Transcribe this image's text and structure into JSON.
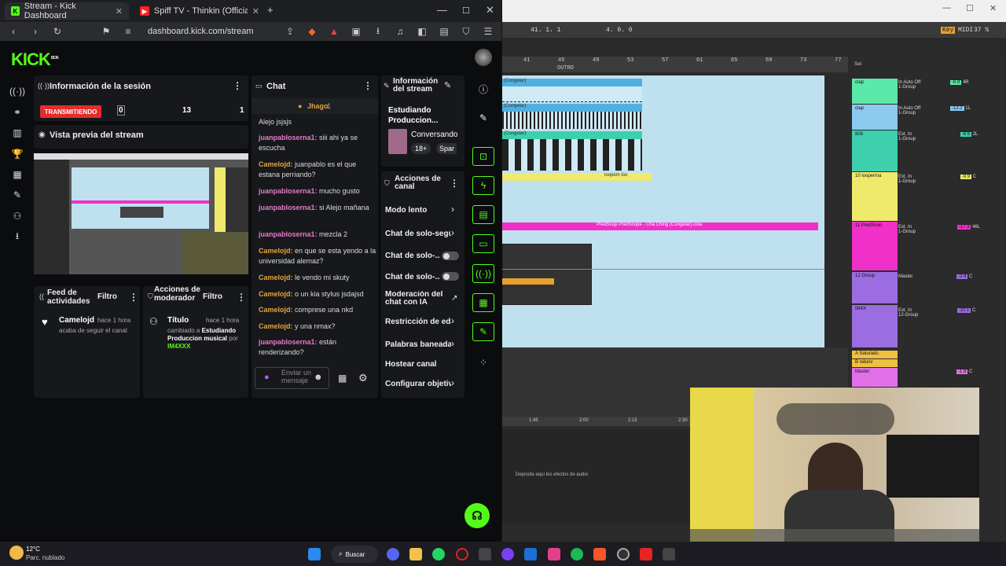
{
  "browser": {
    "tabs": [
      {
        "label": "Stream - Kick Dashboard",
        "favicon": "kick-icon"
      },
      {
        "label": "Spiff TV - Thinkin (Official Video) ft. A",
        "favicon": "youtube-icon"
      }
    ],
    "new_tab": "+",
    "window_controls": {
      "minimize": "—",
      "maximize": "☐",
      "close": "✕"
    },
    "url": "dashboard.kick.com/stream"
  },
  "kick": {
    "logo": "KICK",
    "logo_tag": "BETA",
    "session": {
      "title": "Información de la sesión",
      "status_badge": "TRANSMITIENDO",
      "stats": [
        "0",
        "13",
        "1"
      ]
    },
    "preview_title": "Vista previa del stream",
    "activity_feed": {
      "title": "Feed de actividades",
      "filter": "Filtro",
      "item": {
        "user": "Camelojd",
        "time": "hace 1 hora",
        "text": "acaba de seguir el canal"
      }
    },
    "mod_actions": {
      "title": "Acciones de moderador",
      "filter": "Filtro",
      "item": {
        "field": "Título",
        "time": "hace 1 hora",
        "text_prefix": "cambiado a",
        "value": "Estudiando Produccion musical",
        "text_by": "por",
        "user": "IM4XXX"
      }
    },
    "chat": {
      "title": "Chat",
      "pinned_user": "Jhago",
      "pinned_count": "1",
      "messages": [
        {
          "user": "",
          "text": "Alejo jsjsjs"
        },
        {
          "user": "juanpabloserna1:",
          "text": "siii ahi ya se escucha"
        },
        {
          "user": "Camelojd:",
          "text": "juanpablo es el que estana perriando?"
        },
        {
          "user": "juanpabloserna1:",
          "text": "mucho gusto"
        },
        {
          "user": "juanpabloserna1:",
          "text": "si Alejo mañana"
        },
        {
          "user": "juanpabloserna1:",
          "text": "mezcla 2"
        },
        {
          "user": "Camelojd:",
          "text": "en que se esta yendo a la universidad alemaz?"
        },
        {
          "user": "Camelojd:",
          "text": "le vendo mi skuty"
        },
        {
          "user": "Camelojd:",
          "text": "o un kia stylus jsdajsd"
        },
        {
          "user": "Camelojd:",
          "text": "comprese una nkd"
        },
        {
          "user": "Camelojd:",
          "text": "y una nmax?"
        },
        {
          "user": "juanpabloserna1:",
          "text": "están renderizando?"
        }
      ],
      "input_placeholder": "Enviar un mensaje"
    },
    "stream_info": {
      "title": "Información del stream",
      "stream_title": "Estudiando Produccion...",
      "category": "Conversando",
      "tags": [
        "18+",
        "Spar"
      ]
    },
    "stream_actions": {
      "title": "Acciones de canal",
      "items": [
        "Modo lento",
        "Chat de solo-seguidores",
        "Chat de solo-...",
        "Chat de solo-...",
        "Moderación del chat con IA",
        "Restricción de edad",
        "Palabras baneadas",
        "Hostear canal",
        "Configurar objetivos"
      ]
    }
  },
  "daw": {
    "tempo_readout": "41.  1.  1",
    "loop_readout": "4.  0.  0",
    "key_label": "Key",
    "midi_label": "MIDI",
    "cpu": "37 %",
    "ruler_marks": [
      "41",
      "45",
      "49",
      "53",
      "57",
      "61",
      "65",
      "69",
      "73",
      "77"
    ],
    "outro_label": "OUTRO",
    "set_label": "Set",
    "clip_label": "(Congelar)",
    "loop_clip": "loopem loo",
    "pink_clip": "PredScop PredScope - Cha Ching (Congelar).cola",
    "tracks": [
      {
        "name": "clap",
        "color": "#5ce8a8",
        "vol": "-6.9",
        "pan": "4R",
        "route": "In  Auto  Off",
        "group": "1-Group"
      },
      {
        "name": "clap",
        "color": "#8ccaf0",
        "vol": "-13.2",
        "pan": "1L",
        "route": "In  Auto  Off",
        "group": "1-Group"
      },
      {
        "name": "808",
        "color": "#3ecfae",
        "vol": "-8.6",
        "pan": "2L",
        "route": "Ext. In",
        "group": "1-Group"
      },
      {
        "name": "10 looperma",
        "color": "#f0ea6c",
        "vol": "-9.9",
        "pan": "C",
        "route": "Ext. In",
        "group": "1-Group"
      },
      {
        "name": "11 PredScoo",
        "color": "#f030c8",
        "vol": "-17.3",
        "pan": "46L",
        "route": "Ext. In",
        "group": "1-Group"
      },
      {
        "name": "12 Group",
        "color": "#9b6de0",
        "vol": "-2.4",
        "pan": "C",
        "route": "Master",
        "group": ""
      },
      {
        "name": "IM4X",
        "color": "#9b6de0",
        "vol": "-10.1",
        "pan": "C",
        "route": "Ext. In",
        "group": "12-Group"
      },
      {
        "name": "A Saturado",
        "color": "#f0c040",
        "vol": "",
        "pan": "",
        "route": "",
        "group": ""
      },
      {
        "name": "B reberv",
        "color": "#f0c040",
        "vol": "",
        "pan": "",
        "route": "",
        "group": ""
      },
      {
        "name": "Master",
        "color": "#e070e8",
        "vol": "-1.8",
        "pan": "C",
        "route": "",
        "group": ""
      }
    ],
    "time_marks": [
      "1:45",
      "2:00",
      "2:15",
      "2:30"
    ],
    "drop_hint": "Deposite aquí los efectos de audio"
  },
  "taskbar": {
    "weather_temp": "12°C",
    "weather_desc": "Parc. nublado",
    "search_label": "Buscar"
  }
}
